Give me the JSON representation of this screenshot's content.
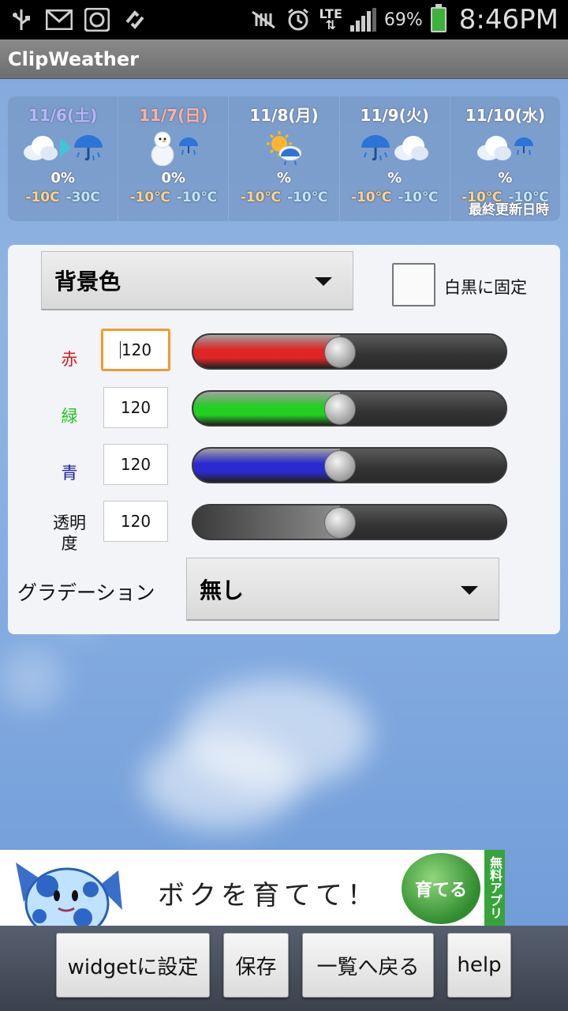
{
  "status_bar": {
    "network": "LTE",
    "battery_percent": "69%",
    "time": "8:46PM",
    "icons": [
      "usb-icon",
      "gmail-icon",
      "app-icon",
      "sync-icon",
      "mute-icon",
      "alarm-icon",
      "signal-icon",
      "battery-icon"
    ]
  },
  "app": {
    "title": "ClipWeather"
  },
  "forecast": {
    "days": [
      {
        "date": "11/6(土)",
        "date_color": "#b6b6ff",
        "pct": "0%",
        "min": "-10C",
        "max": "-30C"
      },
      {
        "date": "11/7(日)",
        "date_color": "#ffb0a0",
        "pct": "0%",
        "min": "-10℃",
        "max": "-10℃"
      },
      {
        "date": "11/8(月)",
        "date_color": "#ffffff",
        "pct": "%",
        "min": "-10℃",
        "max": "-10℃"
      },
      {
        "date": "11/9(火)",
        "date_color": "#ffffff",
        "pct": "%",
        "min": "-10℃",
        "max": "-10℃"
      },
      {
        "date": "11/10(水)",
        "date_color": "#ffffff",
        "pct": "%",
        "min": "-10℃",
        "max": "-10℃"
      }
    ],
    "updated_label": "最終更新日時"
  },
  "settings": {
    "target_select": "背景色",
    "monochrome_label": "白黒に固定",
    "monochrome_checked": false,
    "rows": [
      {
        "label": "赤",
        "color": "#e01818",
        "value": "120",
        "level": 0.47,
        "fill": "#e02525"
      },
      {
        "label": "緑",
        "color": "#1ec81e",
        "value": "120",
        "level": 0.47,
        "fill": "#22d022"
      },
      {
        "label": "青",
        "color": "#1c1ca8",
        "value": "120",
        "level": 0.47,
        "fill": "#2a2ad0"
      },
      {
        "label": "透明\n度",
        "color": "#111111",
        "value": "120",
        "level": 0.47,
        "fill": "#888888"
      }
    ],
    "gradient_label": "グラデーション",
    "gradient_select": "無し"
  },
  "ad": {
    "text": "ボクを育てて！",
    "badge": "育てる",
    "side": "無料アプリ"
  },
  "buttons": {
    "widget": "widgetに設定",
    "save": "保存",
    "back": "一覧へ戻る",
    "help": "help"
  }
}
